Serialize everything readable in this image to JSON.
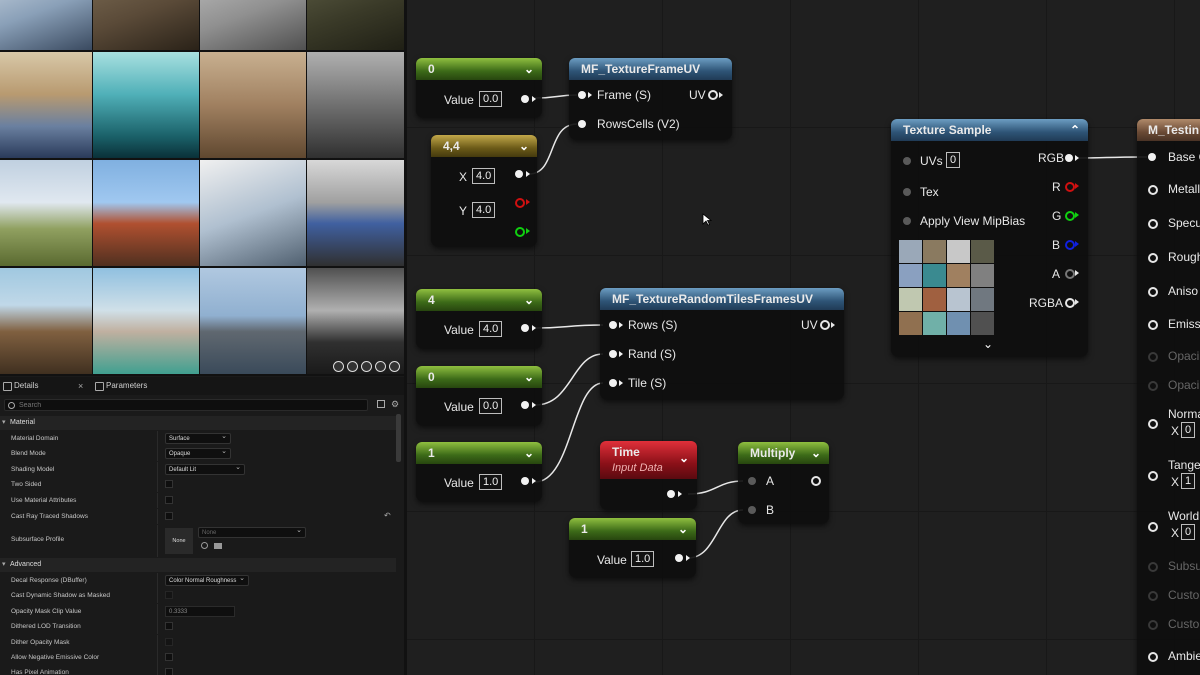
{
  "details_panel": {
    "tabs": [
      {
        "label": "Details",
        "close": "×"
      },
      {
        "label": "Parameters"
      }
    ],
    "search_placeholder": "Search",
    "sections": {
      "material": "Material",
      "advanced": "Advanced"
    },
    "material_props": [
      {
        "label": "Material Domain",
        "value": "Surface"
      },
      {
        "label": "Blend Mode",
        "value": "Opaque"
      },
      {
        "label": "Shading Model",
        "value": "Default Lit"
      },
      {
        "label": "Two Sided"
      },
      {
        "label": "Use Material Attributes"
      },
      {
        "label": "Cast Ray Traced Shadows"
      },
      {
        "label": "Subsurface Profile",
        "value": "None",
        "thumb_label": "None"
      }
    ],
    "advanced_props": [
      {
        "label": "Decal Response (DBuffer)",
        "value": "Color Normal Roughness"
      },
      {
        "label": "Cast Dynamic Shadow as Masked"
      },
      {
        "label": "Opacity Mask Clip Value",
        "value": "0.3333"
      },
      {
        "label": "Dithered LOD Transition"
      },
      {
        "label": "Dither Opacity Mask"
      },
      {
        "label": "Allow Negative Emissive Color"
      },
      {
        "label": "Has Pixel Animation"
      }
    ]
  },
  "graph": {
    "const1": {
      "title": "0",
      "value_label": "Value",
      "value": "0.0"
    },
    "vec2": {
      "title": "4,4",
      "x_label": "X",
      "x": "4.0",
      "y_label": "Y",
      "y": "4.0"
    },
    "frame_uv": {
      "title": "MF_TextureFrameUV",
      "in1": "Frame (S)",
      "in2": "RowsCells (V2)",
      "out": "UV"
    },
    "const2": {
      "title": "4",
      "value_label": "Value",
      "value": "4.0"
    },
    "const3": {
      "title": "0",
      "value_label": "Value",
      "value": "0.0"
    },
    "const4": {
      "title": "1",
      "value_label": "Value",
      "value": "1.0"
    },
    "random_tiles": {
      "title": "MF_TextureRandomTilesFramesUV",
      "in1": "Rows (S)",
      "in2": "Rand (S)",
      "in3": "Tile (S)",
      "out": "UV"
    },
    "time": {
      "title": "Time",
      "subtitle": "Input Data"
    },
    "const5": {
      "title": "1",
      "value_label": "Value",
      "value": "1.0"
    },
    "multiply": {
      "title": "Multiply",
      "a": "A",
      "b": "B"
    },
    "texture_sample": {
      "title": "Texture Sample",
      "uvs_label": "UVs",
      "uvs_value": "0",
      "tex": "Tex",
      "mip": "Apply View MipBias",
      "out_rgb": "RGB",
      "out_r": "R",
      "out_g": "G",
      "out_b": "B",
      "out_a": "A",
      "out_rgba": "RGBA"
    },
    "material_node": {
      "title": "M_Testin",
      "pins": [
        "Base C",
        "Metall",
        "Specu",
        "Rough",
        "Aniso",
        "Emiss",
        "Opaci",
        "Opaci",
        "Norma",
        "Tange",
        "World",
        "Subsu",
        "Custo",
        "Custo",
        "Ambie"
      ],
      "sub_x": "X",
      "normal_x": "0",
      "tangent_x": "1",
      "world_x": "0"
    }
  },
  "colors": {
    "const_header": "#3c6a18",
    "vector_header": "#6b5a18",
    "function_header": "#2e5476",
    "time_header": "#8a1018",
    "material_header": "#6a4a35"
  }
}
